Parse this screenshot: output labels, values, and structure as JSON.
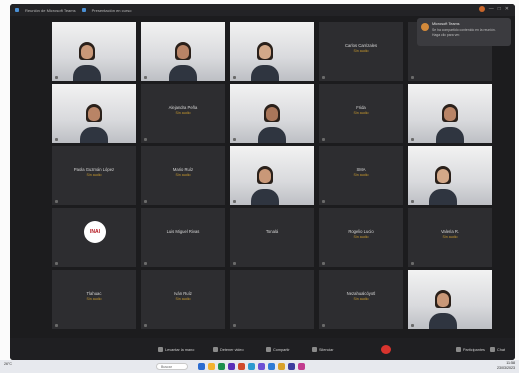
{
  "window": {
    "title": "Reunión de Microsoft Teams",
    "secondary": "Presentación en curso",
    "controls": [
      "—",
      "□",
      "✕"
    ]
  },
  "notification": {
    "name": "Microsoft Teams",
    "body": "Se ha compartido contenido en la reunión. Haga clic para ver."
  },
  "participants": [
    {
      "type": "video",
      "name": ""
    },
    {
      "type": "video",
      "name": ""
    },
    {
      "type": "video",
      "name": ""
    },
    {
      "type": "name",
      "name": "Carlos Carrizales",
      "sub": "Sin audio"
    },
    {
      "type": "blank",
      "name": ""
    },
    {
      "type": "video",
      "name": ""
    },
    {
      "type": "name",
      "name": "Alejandra Peña",
      "sub": "Sin audio"
    },
    {
      "type": "video",
      "name": ""
    },
    {
      "type": "name",
      "name": "Frida",
      "sub": "Sin audio"
    },
    {
      "type": "video",
      "name": ""
    },
    {
      "type": "name",
      "name": "Paola Guzmán López",
      "sub": "Sin audio"
    },
    {
      "type": "name",
      "name": "Mario Ruíz",
      "sub": "Sin audio"
    },
    {
      "type": "video",
      "name": ""
    },
    {
      "type": "name",
      "name": "SMA",
      "sub": "Sin audio"
    },
    {
      "type": "video",
      "name": ""
    },
    {
      "type": "logo",
      "name": "INAI"
    },
    {
      "type": "name",
      "name": "Luis Miguel Rivas",
      "sub": ""
    },
    {
      "type": "name",
      "name": "Tonalá",
      "sub": ""
    },
    {
      "type": "name",
      "name": "Rogelio Lucio",
      "sub": "Sin audio"
    },
    {
      "type": "name",
      "name": "Valeria R.",
      "sub": "Sin audio"
    },
    {
      "type": "name",
      "name": "Tlahuac",
      "sub": "Sin audio"
    },
    {
      "type": "name",
      "name": "Iván Ruíz",
      "sub": "Sin audio"
    },
    {
      "type": "blank",
      "name": ""
    },
    {
      "type": "name",
      "name": "Nezahualcóyotl",
      "sub": "Sin audio"
    },
    {
      "type": "video",
      "name": ""
    }
  ],
  "toolbar": {
    "buttons": [
      {
        "label": "Levantar la mano",
        "icon": "hand-icon"
      },
      {
        "label": "Detener video",
        "icon": "camera-icon"
      },
      {
        "label": "Compartir",
        "icon": "share-icon"
      },
      {
        "label": "Silenciar",
        "icon": "mic-icon"
      },
      {
        "label": "Participantes",
        "icon": "people-icon"
      },
      {
        "label": "Chat",
        "icon": "chat-icon"
      }
    ]
  },
  "taskbar": {
    "weather": "26°C",
    "search": "Buscar",
    "time": "11:58",
    "date": "23/03/2023"
  },
  "colors": {
    "screen_bg": "#1c1c1e",
    "tile_bg": "#2d2d30",
    "status": "#c99a2e",
    "hangup": "#d8342e"
  }
}
